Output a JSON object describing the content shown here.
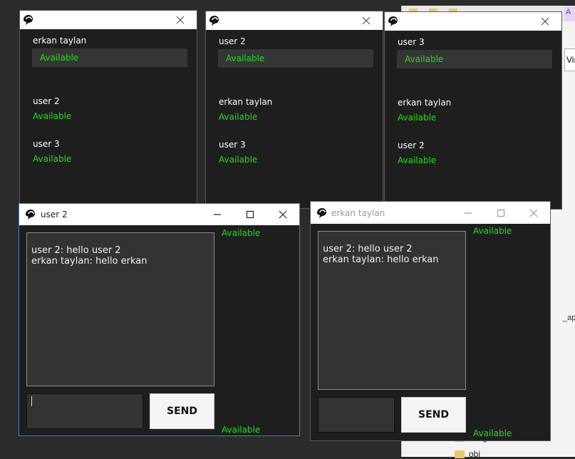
{
  "colors": {
    "available": "#22dd22",
    "window_bg": "#1e1e1e",
    "titlebar_bg": "#ffffff"
  },
  "contacts_windows": [
    {
      "self": {
        "name": "erkan taylan",
        "status": "Available"
      },
      "contacts": [
        {
          "name": "user 2",
          "status": "Available"
        },
        {
          "name": "user 3",
          "status": "Available"
        }
      ]
    },
    {
      "self": {
        "name": "user 2",
        "status": "Available"
      },
      "contacts": [
        {
          "name": "erkan taylan",
          "status": "Available"
        },
        {
          "name": "user 3",
          "status": "Available"
        }
      ]
    },
    {
      "self": {
        "name": "user 3",
        "status": "Available"
      },
      "contacts": [
        {
          "name": "erkan taylan",
          "status": "Available"
        },
        {
          "name": "user 2",
          "status": "Available"
        }
      ]
    }
  ],
  "chat_windows": [
    {
      "title": "user 2",
      "status_top": "Available",
      "status_bottom": "Available",
      "messages": [
        "user 2: hello user 2",
        "erkan taylan: hello erkan"
      ],
      "input_value": "",
      "send_label": "SEND"
    },
    {
      "title": "erkan taylan",
      "status_top": "Available",
      "status_bottom": "Available",
      "messages": [
        "user 2: hello user 2",
        "erkan taylan: hello erkan"
      ],
      "input_value": "",
      "send_label": "SEND"
    }
  ],
  "background_app": {
    "tab_text": "A",
    "nav_text": "Vis",
    "side_text": "_app",
    "folders": [
      "images",
      "obj"
    ]
  }
}
